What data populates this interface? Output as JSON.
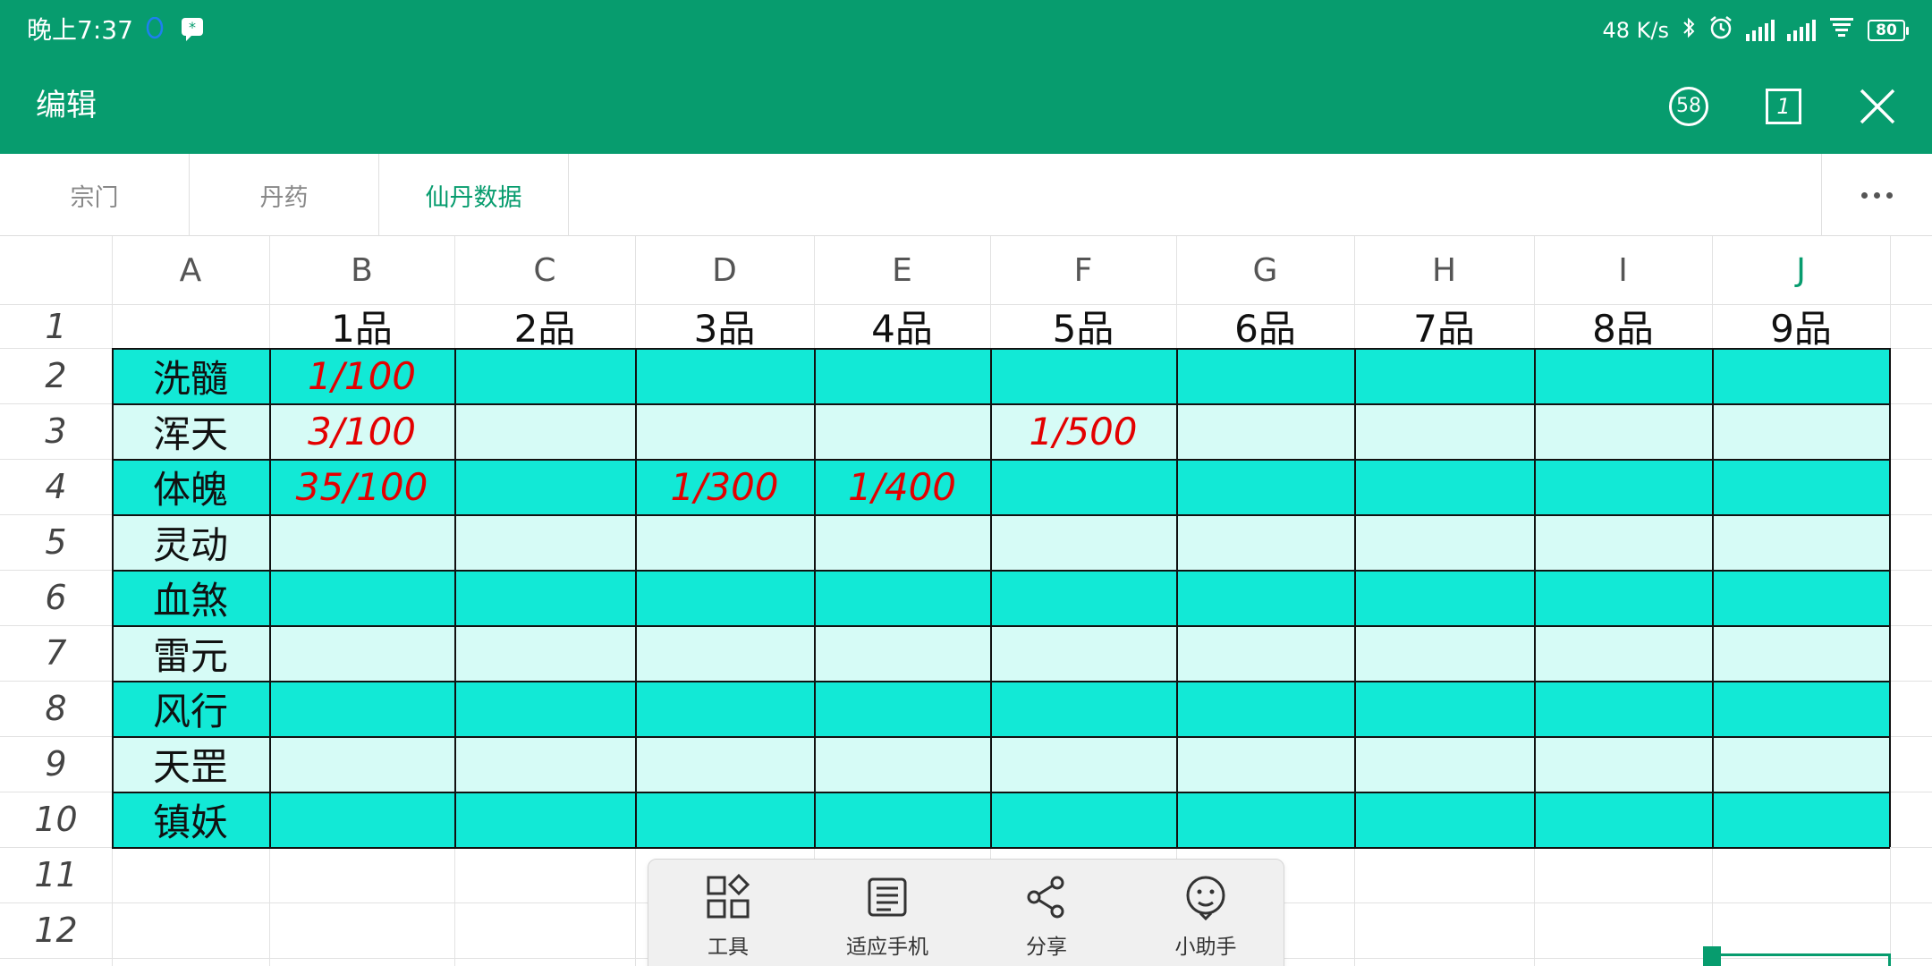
{
  "status_bar": {
    "time": "晚上7:37",
    "net_speed": "48 K/s",
    "battery": "80",
    "icons": [
      "qq-icon",
      "chat-bubble-icon",
      "bluetooth-icon",
      "alarm-icon",
      "signal-icon",
      "signal-icon",
      "wifi-icon"
    ]
  },
  "header": {
    "title": "编辑",
    "badge_count": "58",
    "page_indicator": "1"
  },
  "tabs": [
    {
      "label": "宗门"
    },
    {
      "label": "丹药"
    },
    {
      "label": "仙丹数据"
    }
  ],
  "active_tab": "仙丹数据",
  "columns": [
    "A",
    "B",
    "C",
    "D",
    "E",
    "F",
    "G",
    "H",
    "I",
    "J"
  ],
  "rows": [
    "1",
    "2",
    "3",
    "4",
    "5",
    "6",
    "7",
    "8",
    "9",
    "10",
    "11",
    "12"
  ],
  "table": {
    "header_row": [
      "",
      "1品",
      "2品",
      "3品",
      "4品",
      "5品",
      "6品",
      "7品",
      "8品",
      "9品"
    ],
    "row_labels": [
      "洗髓",
      "浑天",
      "体魄",
      "灵动",
      "血煞",
      "雷元",
      "风行",
      "天罡",
      "镇妖"
    ],
    "values": {
      "B2": "1/100",
      "B3": "3/100",
      "F3": "1/500",
      "B4": "35/100",
      "D4": "1/300",
      "E4": "1/400"
    }
  },
  "toolbar": {
    "items": [
      {
        "label": "工具",
        "icon": "grid-tools-icon"
      },
      {
        "label": "适应手机",
        "icon": "fit-phone-icon"
      },
      {
        "label": "分享",
        "icon": "share-icon"
      },
      {
        "label": "小助手",
        "icon": "assistant-face-icon"
      }
    ]
  },
  "colors": {
    "header_green": "#079c6e",
    "teal_dark": "#12e9d6",
    "teal_light": "#d6fbf6",
    "value_red": "#e30000"
  }
}
